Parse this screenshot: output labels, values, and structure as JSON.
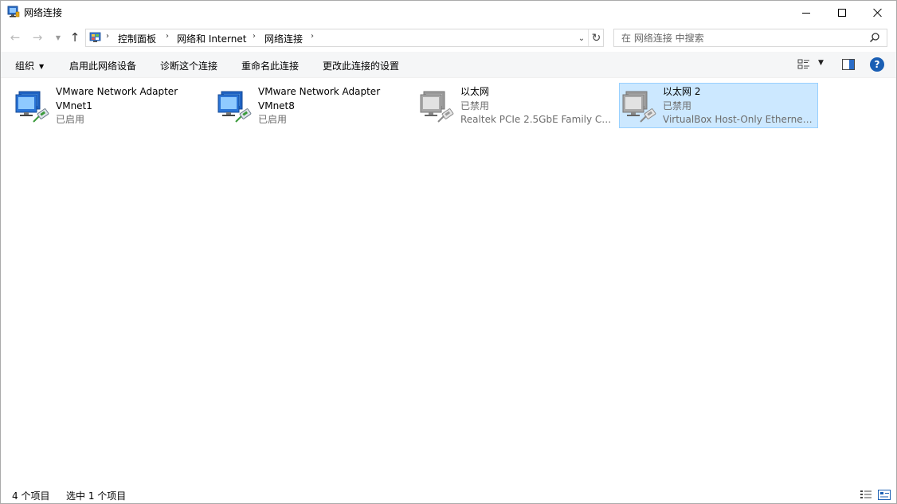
{
  "window": {
    "title": "网络连接",
    "icon": "network-connections-icon"
  },
  "nav": {
    "breadcrumbs": [
      "控制面板",
      "网络和 Internet",
      "网络连接"
    ],
    "search_placeholder": "在 网络连接 中搜索"
  },
  "commands": {
    "organize": "组织",
    "enable": "启用此网络设备",
    "diagnose": "诊断这个连接",
    "rename": "重命名此连接",
    "change_settings": "更改此连接的设置"
  },
  "connections": [
    {
      "name": "VMware Network Adapter",
      "line2": "VMnet1",
      "line3": "已启用",
      "enabled": true,
      "selected": false
    },
    {
      "name": "VMware Network Adapter",
      "line2": "VMnet8",
      "line3": "已启用",
      "enabled": true,
      "selected": false
    },
    {
      "name": "以太网",
      "line2": "已禁用",
      "line3": "Realtek PCIe 2.5GbE Family Co...",
      "enabled": false,
      "selected": false
    },
    {
      "name": "以太网 2",
      "line2": "已禁用",
      "line3": "VirtualBox Host-Only Ethernet ...",
      "enabled": false,
      "selected": true
    }
  ],
  "status": {
    "count": "4 个项目",
    "selection": "选中 1 个项目"
  },
  "colors": {
    "selection_bg": "#cce8ff",
    "selection_border": "#99d1ff",
    "help": "#1a5fb4"
  }
}
